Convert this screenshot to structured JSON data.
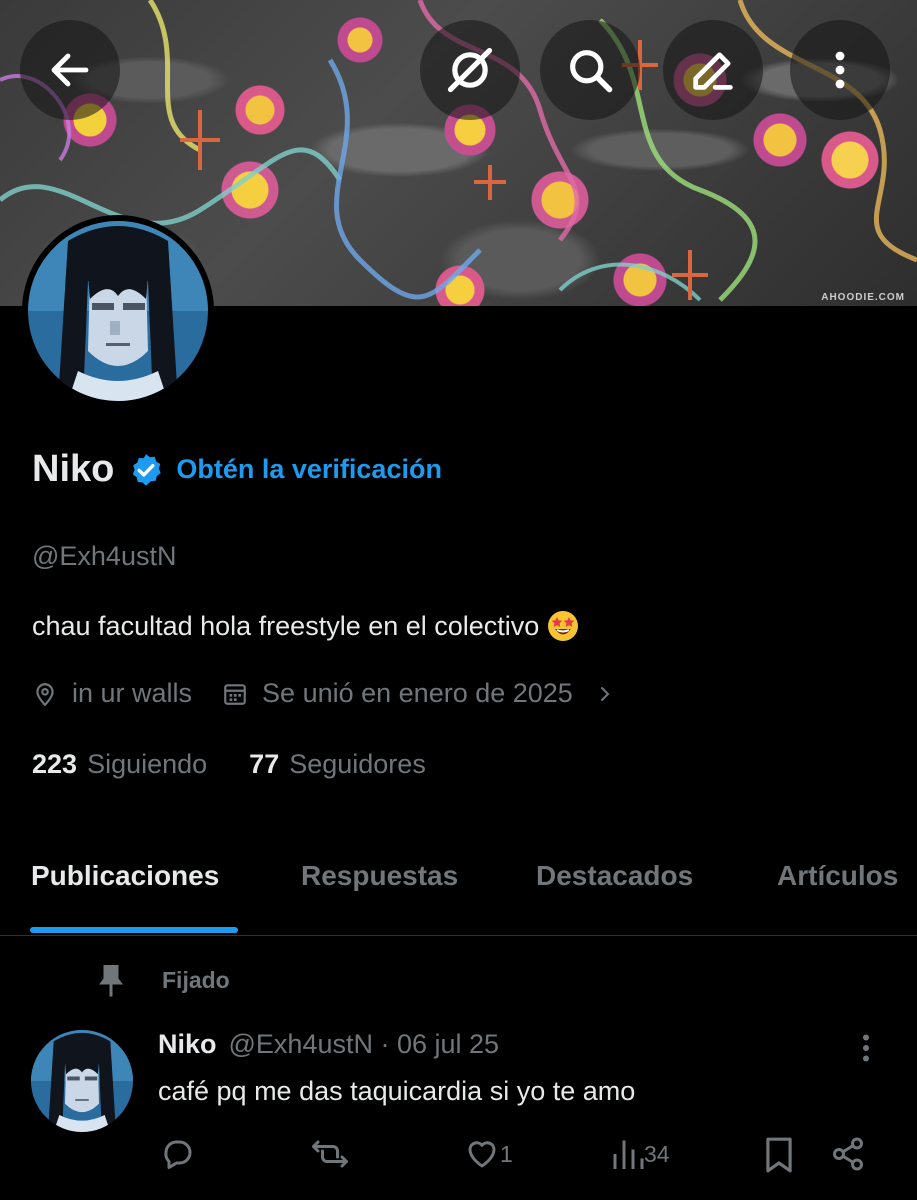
{
  "banner": {
    "watermark": "AHOODIE.COM"
  },
  "profile": {
    "name": "Niko",
    "get_verified": "Obtén la verificación",
    "handle": "@Exh4ustN",
    "bio": "chau facultad hola freestyle en el colectivo",
    "bio_emoji": "star-struck-emoji",
    "location": "in ur walls",
    "joined": "Se unió en enero de 2025",
    "following_count": "223",
    "following_label": "Siguiendo",
    "followers_count": "77",
    "followers_label": "Seguidores"
  },
  "tabs": [
    {
      "label": "Publicaciones",
      "active": true
    },
    {
      "label": "Respuestas",
      "active": false
    },
    {
      "label": "Destacados",
      "active": false
    },
    {
      "label": "Artículos",
      "active": false
    }
  ],
  "post": {
    "pinned_label": "Fijado",
    "name": "Niko",
    "meta": "@Exh4ustN · 06 jul 25",
    "text": "café pq me das taquicardia si yo te amo",
    "likes": "1",
    "views": "34"
  },
  "colors": {
    "accent": "#1d9bf0",
    "secondary_text": "#71767b",
    "background": "#000000"
  }
}
